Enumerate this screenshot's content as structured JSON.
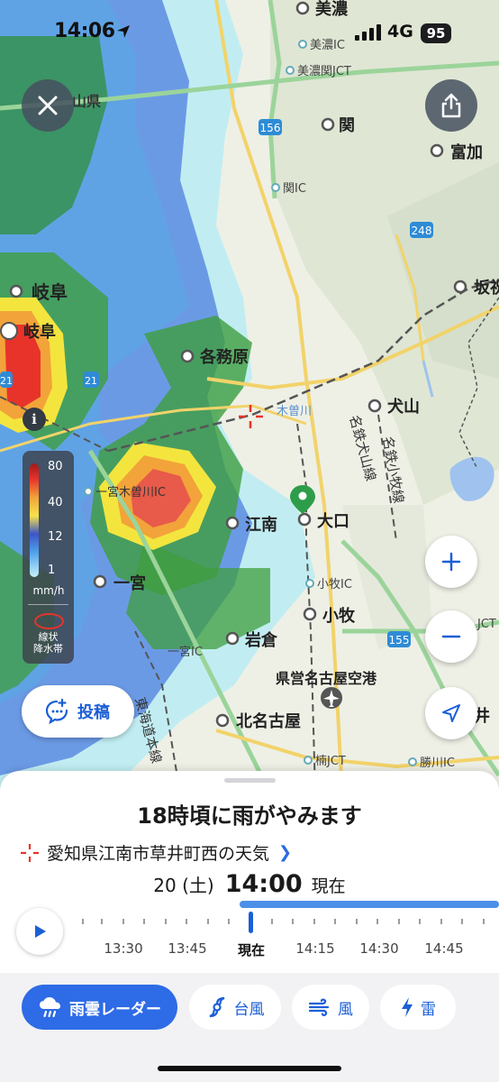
{
  "status_bar": {
    "time": "14:06",
    "network": "4G",
    "battery": "95"
  },
  "map": {
    "places": [
      {
        "name": "美濃"
      },
      {
        "name": "美濃IC"
      },
      {
        "name": "美濃関JCT"
      },
      {
        "name": "山県"
      },
      {
        "name": "関"
      },
      {
        "name": "富加"
      },
      {
        "name": "関IC"
      },
      {
        "name": "坂祝"
      },
      {
        "name": "岐阜"
      },
      {
        "name": "岐阜"
      },
      {
        "name": "各務原"
      },
      {
        "name": "木曽川"
      },
      {
        "name": "犬山"
      },
      {
        "name": "一宮木曽川IC"
      },
      {
        "name": "江南"
      },
      {
        "name": "大口"
      },
      {
        "name": "一宮"
      },
      {
        "name": "小牧IC"
      },
      {
        "name": "小牧"
      },
      {
        "name": "岩倉"
      },
      {
        "name": "一宮IC"
      },
      {
        "name": "県営名古屋空港"
      },
      {
        "name": "北名古屋"
      },
      {
        "name": "楠JCT"
      },
      {
        "name": "勝川IC"
      },
      {
        "name": "名鉄犬山線"
      },
      {
        "name": "名鉄小牧線"
      },
      {
        "name": "東海道本線"
      },
      {
        "name": "JCT"
      },
      {
        "name": "井"
      }
    ],
    "route_shields": [
      "156",
      "248",
      "155",
      "21",
      "21"
    ]
  },
  "legend": {
    "ticks": [
      "80",
      "40",
      "12",
      "1"
    ],
    "unit": "mm/h",
    "band_label_1": "線状",
    "band_label_2": "降水帯"
  },
  "post_button": {
    "label": "投稿"
  },
  "sheet": {
    "headline": "18時頃に雨がやみます",
    "location": "愛知県江南市草井町西の天気",
    "date": "20 (土)",
    "time": "14:00",
    "now_label": "現在",
    "timeline_labels": [
      "13:30",
      "13:45",
      "現在",
      "14:15",
      "14:30",
      "14:45"
    ]
  },
  "tabs": [
    {
      "label": "雨雲レーダー",
      "icon": "rain-cloud-icon",
      "active": true
    },
    {
      "label": "台風",
      "icon": "typhoon-icon",
      "active": false
    },
    {
      "label": "風",
      "icon": "wind-icon",
      "active": false
    },
    {
      "label": "雷",
      "icon": "lightning-icon",
      "active": false
    }
  ],
  "colors": {
    "accent": "#2e6be6",
    "rain_heavy": "#e8332a",
    "rain_mid": "#f7e34a",
    "rain_light": "#4fa0e8"
  }
}
